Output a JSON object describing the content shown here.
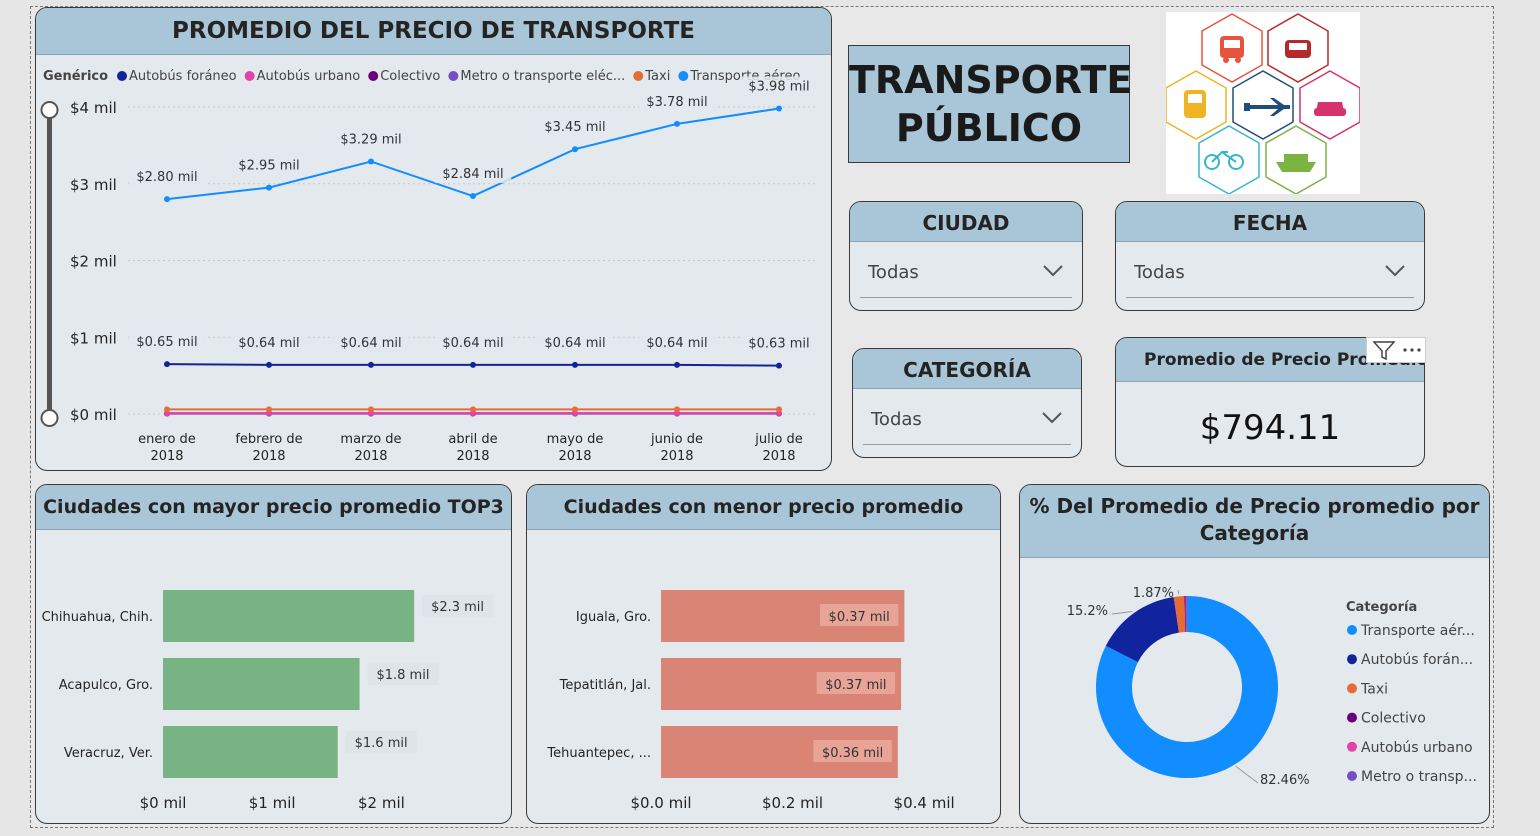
{
  "line_card": {
    "title": "PROMEDIO DEL PRECIO DE TRANSPORTE",
    "legend_title": "Genérico",
    "legend": [
      {
        "label": "Autobús foráneo",
        "color": "#12239e"
      },
      {
        "label": "Autobús urbano",
        "color": "#e044a7"
      },
      {
        "label": "Colectivo",
        "color": "#6b007b"
      },
      {
        "label": "Metro o transporte eléc...",
        "color": "#744ec2"
      },
      {
        "label": "Taxi",
        "color": "#e66c37"
      },
      {
        "label": "Transporte aéreo",
        "color": "#118dff"
      }
    ],
    "y_ticks": [
      "$4 mil",
      "$3 mil",
      "$2 mil",
      "$1 mil",
      "$0 mil"
    ],
    "x_ticks": [
      [
        "enero de",
        "2018"
      ],
      [
        "febrero de",
        "2018"
      ],
      [
        "marzo de",
        "2018"
      ],
      [
        "abril de",
        "2018"
      ],
      [
        "mayo de",
        "2018"
      ],
      [
        "junio de",
        "2018"
      ],
      [
        "julio de",
        "2018"
      ]
    ],
    "aereo_labels": [
      "$2.80 mil",
      "$2.95 mil",
      "$3.29 mil",
      "$2.84 mil",
      "$3.45 mil",
      "$3.78 mil",
      "$3.98 mil"
    ],
    "foraneo_labels": [
      "$0.65 mil",
      "$0.64 mil",
      "$0.64 mil",
      "$0.64 mil",
      "$0.64 mil",
      "$0.64 mil",
      "$0.63 mil"
    ]
  },
  "title_box": {
    "line1": "TRANSPORTE",
    "line2": "PÚBLICO"
  },
  "logo": {
    "icons": [
      "bus-icon",
      "taxi-icon",
      "train-icon",
      "airplane-icon",
      "car-icon",
      "bicycle-icon",
      "ship-icon"
    ]
  },
  "slicers": {
    "ciudad": {
      "title": "CIUDAD",
      "value": "Todas"
    },
    "fecha": {
      "title": "FECHA",
      "value": "Todas"
    },
    "categoria": {
      "title": "CATEGORÍA",
      "value": "Todas"
    }
  },
  "kpi": {
    "title": "Promedio de Precio Promedio",
    "value": "$794.11"
  },
  "bar_top": {
    "title": "Ciudades con mayor precio promedio TOP3",
    "x_ticks": [
      "$0 mil",
      "$1 mil",
      "$2 mil"
    ],
    "labels": [
      "$2.3 mil",
      "$1.8 mil",
      "$1.6 mil"
    ]
  },
  "bar_low": {
    "title": "Ciudades con menor precio promedio",
    "x_ticks": [
      "$0.0 mil",
      "$0.2 mil",
      "$0.4 mil"
    ],
    "labels": [
      "$0.37 mil",
      "$0.37 mil",
      "$0.36 mil"
    ]
  },
  "donut": {
    "title_line1": "% Del Promedio de Precio promedio por",
    "title_line2": "Categoría",
    "legend_title": "Categoría",
    "legend": [
      {
        "label": "Transporte aér...",
        "color": "#118dff"
      },
      {
        "label": "Autobús forán...",
        "color": "#12239e"
      },
      {
        "label": "Taxi",
        "color": "#e66c37"
      },
      {
        "label": "Colectivo",
        "color": "#6b007b"
      },
      {
        "label": "Autobús urbano",
        "color": "#e044a7"
      },
      {
        "label": "Metro o transp...",
        "color": "#744ec2"
      }
    ],
    "labels": [
      "82.46%",
      "15.2%",
      "1.87%"
    ]
  },
  "chart_data": [
    {
      "type": "line",
      "title": "PROMEDIO DEL PRECIO DE TRANSPORTE",
      "x": [
        "enero de 2018",
        "febrero de 2018",
        "marzo de 2018",
        "abril de 2018",
        "mayo de 2018",
        "junio de 2018",
        "julio de 2018"
      ],
      "ylim": [
        0,
        4000
      ],
      "series": [
        {
          "name": "Transporte aéreo",
          "color": "#118dff",
          "values": [
            2800,
            2950,
            3290,
            2840,
            3450,
            3780,
            3980
          ]
        },
        {
          "name": "Autobús foráneo",
          "color": "#12239e",
          "values": [
            650,
            640,
            640,
            640,
            640,
            640,
            630
          ]
        },
        {
          "name": "Taxi",
          "color": "#e66c37",
          "values": [
            60,
            60,
            60,
            60,
            60,
            60,
            60
          ]
        },
        {
          "name": "Autobús urbano",
          "color": "#e044a7",
          "values": [
            10,
            10,
            10,
            10,
            10,
            10,
            10
          ]
        },
        {
          "name": "Colectivo",
          "color": "#6b007b",
          "values": [
            10,
            10,
            10,
            10,
            10,
            10,
            10
          ]
        },
        {
          "name": "Metro o transporte eléc...",
          "color": "#744ec2",
          "values": [
            5,
            5,
            5,
            5,
            5,
            5,
            5
          ]
        }
      ]
    },
    {
      "type": "bar",
      "title": "Ciudades con mayor precio promedio TOP3",
      "categories": [
        "Chihuahua, Chih.",
        "Acapulco, Gro.",
        "Veracruz, Ver."
      ],
      "values": [
        2300,
        1800,
        1600
      ],
      "xlim": [
        0,
        2500
      ],
      "color": "#77b383"
    },
    {
      "type": "bar",
      "title": "Ciudades con menor precio promedio",
      "categories": [
        "Iguala, Gro.",
        "Tepatitlán, Jal.",
        "Tehuantepec, ..."
      ],
      "values": [
        370,
        365,
        360
      ],
      "xlim": [
        0,
        0.45
      ],
      "color": "#d98474"
    },
    {
      "type": "pie",
      "title": "% Del Promedio de Precio promedio por Categoría",
      "categories": [
        "Transporte aéreo",
        "Autobús foráneo",
        "Taxi",
        "Colectivo",
        "Autobús urbano",
        "Metro o transporte eléc..."
      ],
      "values": [
        82.46,
        15.2,
        1.87,
        0.2,
        0.15,
        0.12
      ],
      "colors": [
        "#118dff",
        "#12239e",
        "#e66c37",
        "#6b007b",
        "#e044a7",
        "#744ec2"
      ]
    }
  ]
}
